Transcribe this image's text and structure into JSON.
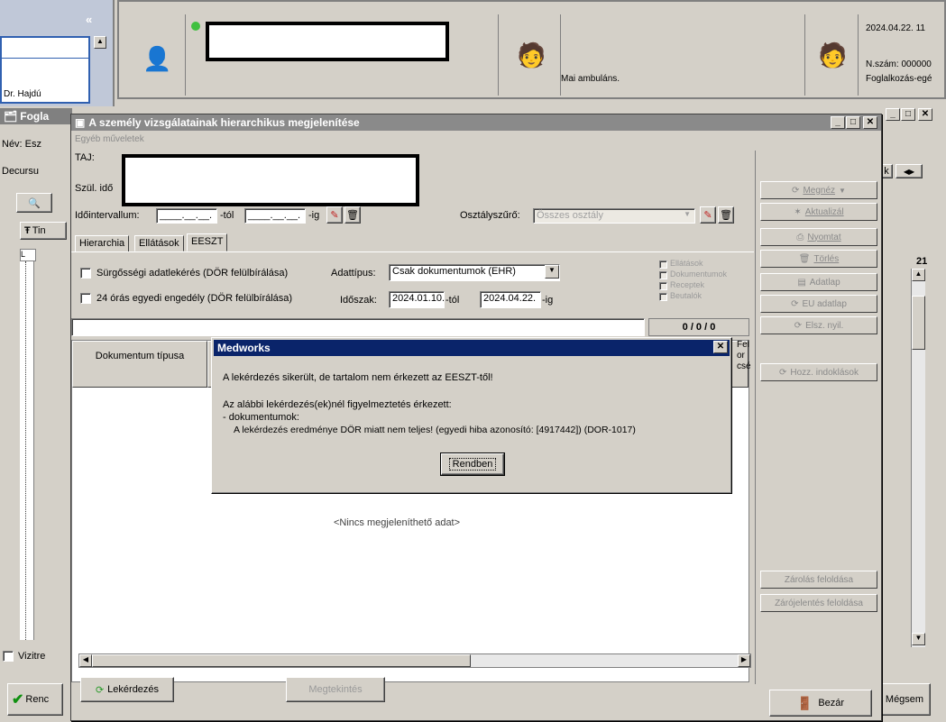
{
  "top_panel": {
    "doctor": "Dr. Hajdú",
    "ambulance_label": "Mai ambuláns.",
    "date_time": "2024.04.22. 11",
    "n_number": "N.szám: 000000",
    "occupation": "Foglalkozás-egé"
  },
  "background_window": {
    "title": "Fogla",
    "name_label": "Név: Esz",
    "decursus_label": "Decursu",
    "tab_label": "Tin",
    "ruler_number": "21",
    "nav_label": "k",
    "checkbox_label": "Vizitre",
    "bottom_left_button": "Renc",
    "bottom_right_button": "Mégsem"
  },
  "main_window": {
    "title": "A személy vizsgálatainak hierarchikus megjelenítése",
    "menu": "Egyéb műveletek",
    "taj_label": "TAJ:",
    "szul_label": "Szül. idő",
    "idointervallum_label": "Időintervallum:",
    "date_from_placeholder": "____.__.__.",
    "tol_label": "-tól",
    "date_to_placeholder": "____.__.__.",
    "ig_label": "-ig",
    "osztalyszuro_label": "Osztályszűrő:",
    "osztalyszuro_value": "Összes osztály",
    "tabs": [
      "Hierarchia",
      "Ellátások",
      "EESZT"
    ],
    "surgossegi_label": "Sürgősségi adatlekérés (DÖR felülbírálása)",
    "egyedi_label": "24 órás egyedi engedély (DÖR felülbírálása)",
    "adattipus_label": "Adattípus:",
    "adattipus_value": "Csak dokumentumok (EHR)",
    "idoszak_label": "Időszak:",
    "idoszak_from": "2024.01.10.",
    "idoszak_tol": "-tól",
    "idoszak_to": "2024.04.22.",
    "idoszak_ig": "-ig",
    "filter_checks": [
      "Ellátások",
      "Dokumentumok",
      "Receptek",
      "Beutalók"
    ],
    "counter": "0 / 0 / 0",
    "table_header_doc": "Dokumentum típusa",
    "table_header_partial": [
      "Fel",
      "or",
      "csé"
    ],
    "empty_text": "<Nincs megjeleníthető adat>",
    "side_buttons": [
      "Megnéz",
      "Aktualizál",
      "Nyomtat",
      "Törlés",
      "Adatlap",
      "EU adatlap",
      "Elsz. nyil.",
      "Hozz. indoklások"
    ],
    "bottom_side_buttons": [
      "Zárolás feloldása",
      "Zárójelentés feloldása"
    ],
    "lekerdezes_button": "Lekérdezés",
    "megtekintes_button": "Megtekintés",
    "bezar_button": "Bezár"
  },
  "dialog": {
    "title": "Medworks",
    "line1": "A lekérdezés sikerült, de tartalom nem érkezett az EESZT-től!",
    "line2": "Az alábbi lekérdezés(ek)nél figyelmeztetés érkezett:",
    "line3": "- dokumentumok:",
    "line4": "A lekérdezés eredménye DÖR miatt nem teljes! (egyedi hiba azonosító: [4917442]) (DOR-1017)",
    "ok_button": "Rendben"
  },
  "colors": {
    "title_active": "#0a246a",
    "title_inactive": "#808080",
    "face": "#d4d0c8"
  }
}
